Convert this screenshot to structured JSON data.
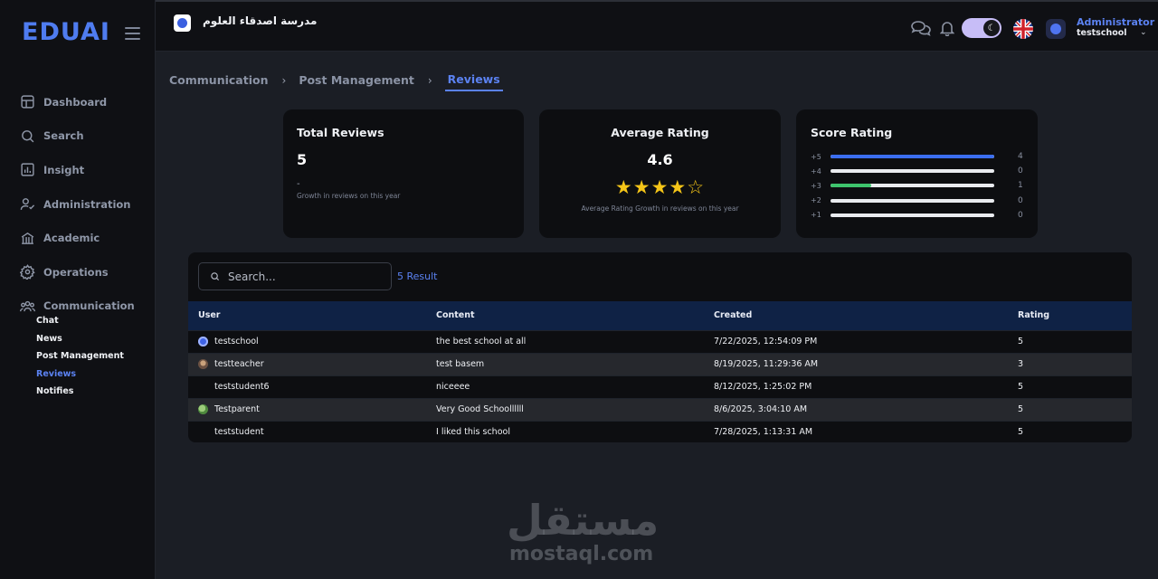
{
  "brand": {
    "logo_text": "EDUAI",
    "accent": "#4f7cf0"
  },
  "sidebar": {
    "items": [
      {
        "label": "Dashboard",
        "icon": "dashboard-icon"
      },
      {
        "label": "Search",
        "icon": "search-icon"
      },
      {
        "label": "Insight",
        "icon": "chart-icon"
      },
      {
        "label": "Administration",
        "icon": "user-check-icon"
      },
      {
        "label": "Academic",
        "icon": "building-icon"
      },
      {
        "label": "Operations",
        "icon": "gear-icon"
      },
      {
        "label": "Communication",
        "icon": "users-icon"
      }
    ],
    "sub_items": [
      "Chat",
      "News",
      "Post Management",
      "Reviews",
      "Notifies"
    ],
    "active_sub": "Reviews"
  },
  "topbar": {
    "school_name": "مدرسة اصدقاء العلوم",
    "user_role": "Administrator",
    "user_school": "testschool",
    "theme": "dark",
    "language_flag": "uk-flag-icon"
  },
  "breadcrumb": [
    "Communication",
    "Post Management",
    "Reviews"
  ],
  "cards": {
    "total": {
      "title": "Total Reviews",
      "value": "5",
      "growth": "-",
      "note": "Growth in reviews on this year"
    },
    "average": {
      "title": "Average Rating",
      "value": "4.6",
      "stars_full": 4,
      "stars_total": 5,
      "note": "Average Rating Growth in reviews on this year"
    },
    "score": {
      "title": "Score Rating",
      "rows": [
        {
          "label": "+5",
          "count": "4",
          "fraction": 1.0,
          "color": "#3b6ef0"
        },
        {
          "label": "+4",
          "count": "0",
          "fraction": 0,
          "color": "#3b6ef0"
        },
        {
          "label": "+3",
          "count": "1",
          "fraction": 0.25,
          "color": "#3ec46d"
        },
        {
          "label": "+2",
          "count": "0",
          "fraction": 0,
          "color": "#3b6ef0"
        },
        {
          "label": "+1",
          "count": "0",
          "fraction": 0,
          "color": "#3b6ef0"
        }
      ]
    }
  },
  "table": {
    "search_placeholder": "Search...",
    "result_text": "5 Result",
    "columns": [
      "User",
      "Content",
      "Created",
      "Rating"
    ],
    "rows": [
      {
        "user": "testschool",
        "avatar": "school-logo",
        "content": "the best school at all",
        "created": "7/22/2025, 12:54:09 PM",
        "rating": "5"
      },
      {
        "user": "testteacher",
        "avatar": "photo",
        "content": "test basem",
        "created": "8/19/2025, 11:29:36 AM",
        "rating": "3"
      },
      {
        "user": "teststudent6",
        "avatar": "none",
        "content": "niceeee",
        "created": "8/12/2025, 1:25:02 PM",
        "rating": "5"
      },
      {
        "user": "Testparent",
        "avatar": "photo-green",
        "content": "Very Good Schoollllll",
        "created": "8/6/2025, 3:04:10 AM",
        "rating": "5"
      },
      {
        "user": "teststudent",
        "avatar": "none",
        "content": "I liked this school",
        "created": "7/28/2025, 1:13:31 AM",
        "rating": "5"
      }
    ]
  },
  "watermark": {
    "arabic": "مستقل",
    "latin": "mostaql.com"
  }
}
